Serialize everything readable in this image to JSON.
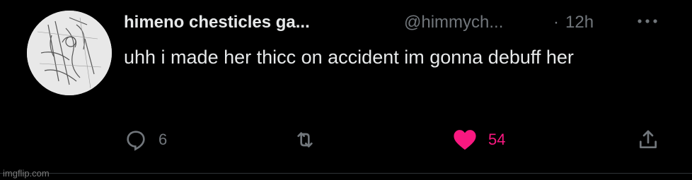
{
  "tweet": {
    "display_name": "himeno chesticles ga...",
    "handle": "@himmych...",
    "separator": "·",
    "time": "12h",
    "text": "uhh i made her thicc on accident im gonna debuff her"
  },
  "actions": {
    "reply": {
      "icon": "reply-icon",
      "count": "6"
    },
    "retweet": {
      "icon": "retweet-icon",
      "count": ""
    },
    "like": {
      "icon": "heart-icon",
      "count": "54",
      "liked": true,
      "color": "#f91880"
    },
    "share": {
      "icon": "share-icon"
    }
  },
  "more_icon": "more-icon",
  "watermark": "imgflip.com",
  "colors": {
    "background": "#000000",
    "primary_text": "#e7e9ea",
    "secondary_text": "#71767b",
    "like": "#f91880"
  }
}
